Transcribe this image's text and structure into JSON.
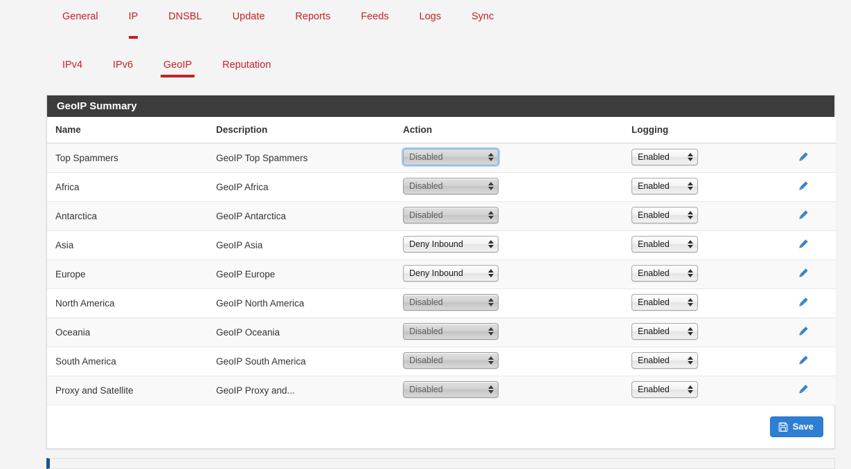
{
  "nav_primary": {
    "items": [
      {
        "label": "General",
        "active": false
      },
      {
        "label": "IP",
        "active": true
      },
      {
        "label": "DNSBL",
        "active": false
      },
      {
        "label": "Update",
        "active": false
      },
      {
        "label": "Reports",
        "active": false
      },
      {
        "label": "Feeds",
        "active": false
      },
      {
        "label": "Logs",
        "active": false
      },
      {
        "label": "Sync",
        "active": false
      }
    ]
  },
  "nav_secondary": {
    "items": [
      {
        "label": "IPv4",
        "active": false
      },
      {
        "label": "IPv6",
        "active": false
      },
      {
        "label": "GeoIP",
        "active": true
      },
      {
        "label": "Reputation",
        "active": false
      }
    ]
  },
  "panel": {
    "title": "GeoIP Summary",
    "columns": [
      "Name",
      "Description",
      "Action",
      "Logging",
      ""
    ],
    "rows": [
      {
        "name": "Top Spammers",
        "description": "GeoIP Top Spammers",
        "action": "Disabled",
        "action_state": "muted",
        "action_focused": true,
        "logging": "Enabled",
        "edit_icon": "pencil-icon"
      },
      {
        "name": "Africa",
        "description": "GeoIP Africa",
        "action": "Disabled",
        "action_state": "muted",
        "action_focused": false,
        "logging": "Enabled",
        "edit_icon": "pencil-icon"
      },
      {
        "name": "Antarctica",
        "description": "GeoIP Antarctica",
        "action": "Disabled",
        "action_state": "muted",
        "action_focused": false,
        "logging": "Enabled",
        "edit_icon": "pencil-icon"
      },
      {
        "name": "Asia",
        "description": "GeoIP Asia",
        "action": "Deny Inbound",
        "action_state": "normal",
        "action_focused": false,
        "logging": "Enabled",
        "edit_icon": "pencil-icon"
      },
      {
        "name": "Europe",
        "description": "GeoIP Europe",
        "action": "Deny Inbound",
        "action_state": "normal",
        "action_focused": false,
        "logging": "Enabled",
        "edit_icon": "pencil-icon"
      },
      {
        "name": "North America",
        "description": "GeoIP North America",
        "action": "Disabled",
        "action_state": "muted",
        "action_focused": false,
        "logging": "Enabled",
        "edit_icon": "pencil-icon"
      },
      {
        "name": "Oceania",
        "description": "GeoIP Oceania",
        "action": "Disabled",
        "action_state": "muted",
        "action_focused": false,
        "logging": "Enabled",
        "edit_icon": "pencil-icon"
      },
      {
        "name": "South America",
        "description": "GeoIP South America",
        "action": "Disabled",
        "action_state": "muted",
        "action_focused": false,
        "logging": "Enabled",
        "edit_icon": "pencil-icon"
      },
      {
        "name": "Proxy and Satellite",
        "description": "GeoIP Proxy and...",
        "action": "Disabled",
        "action_state": "muted",
        "action_focused": false,
        "logging": "Enabled",
        "edit_icon": "pencil-icon"
      }
    ],
    "save_label": "Save",
    "save_icon": "floppy-disk-icon"
  },
  "colors": {
    "accent_red": "#c42126",
    "panel_header": "#3c3c3c",
    "save_blue": "#2d7fd3",
    "pencil_blue": "#3b82c4",
    "bottom_accent": "#16548f",
    "page_bg": "#f4f4f4"
  }
}
